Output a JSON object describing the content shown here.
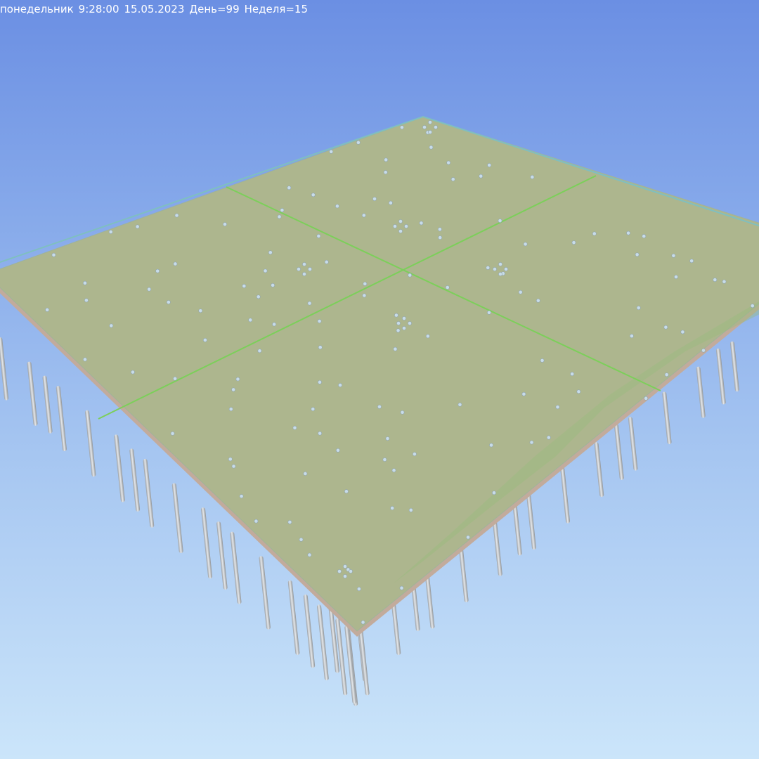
{
  "viewer": {
    "status": {
      "weekday": "понедельник",
      "time": "9:28:00",
      "date": "15.05.2023",
      "day": "День=99",
      "week": "Неделя=15"
    },
    "colors": {
      "sky_top": "#6b8fe3",
      "sky_bottom": "#cbe5fa",
      "slab_fill": "#adb68e",
      "slab_edge": "#c9b3a4",
      "slab_outline": "#7fbfc0",
      "grid_line": "#7ccf5a",
      "terrain_green": "#93b879",
      "pile_fill": "#d4d7da",
      "pile_shade": "#8e9398",
      "marker_fill": "#c8dce8"
    },
    "scene": {
      "object": "foundation-slab",
      "slab_sections": 4,
      "piles": "visible",
      "surface_markers": "visible"
    }
  }
}
